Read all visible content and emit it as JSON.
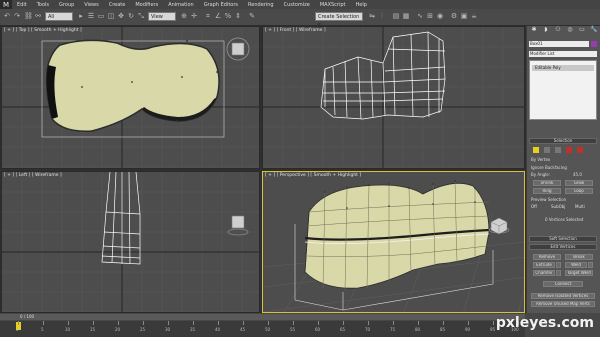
{
  "menubar": {
    "app_glyph": "M",
    "items": [
      "Edit",
      "Tools",
      "Group",
      "Views",
      "Create",
      "Modifiers",
      "Animation",
      "Graph Editors",
      "Rendering",
      "Customize",
      "MAXScript",
      "Help"
    ]
  },
  "toolbar": {
    "filter_value": "All",
    "refsys_value": "View",
    "named_sel_placeholder": "Create Selection S"
  },
  "viewports": {
    "top": {
      "label": "[ + ] [ Top ] [ Smooth + Highlight ]"
    },
    "front": {
      "label": "[ + ] [ Front ] [ Wireframe ]"
    },
    "left": {
      "label": "[ + ] [ Left ] [ Wireframe ]"
    },
    "perspective": {
      "label": "[ + ] [ Perspective ] [ Smooth + Highlight ]"
    }
  },
  "command_panel": {
    "object_name": "Box01",
    "modifier_list": "Modifier List",
    "stack_items": [
      "Editable Poly"
    ],
    "selection_title": "Selection",
    "by_vertex": "By Vertex",
    "ignore_backfacing": "Ignore Backfacing",
    "by_angle": "By Angle:",
    "by_angle_value": "45.0",
    "shrink": "Shrink",
    "grow": "Grow",
    "ring": "Ring",
    "loop": "Loop",
    "preview_selection": "Preview Selection",
    "preview_off": "Off",
    "preview_subobj": "SubObj",
    "preview_multi": "Multi",
    "vertices_selected": "0 Vertices Selected",
    "soft_selection": "Soft Selection",
    "edit_vertices": "Edit Vertices",
    "remove": "Remove",
    "break": "Break",
    "extrude": "Extrude",
    "weld": "Weld",
    "chamfer": "Chamfer",
    "target_weld": "Target Weld",
    "connect": "Connect",
    "remove_isolated": "Remove Isolated Vertices",
    "remove_unused": "Remove Unused Map Verts"
  },
  "timeline": {
    "frame_label": "0 / 100",
    "ticks": [
      "0",
      "5",
      "10",
      "15",
      "20",
      "25",
      "30",
      "35",
      "40",
      "45",
      "50",
      "55",
      "60",
      "65",
      "70",
      "75",
      "80",
      "85",
      "90",
      "95",
      "100"
    ]
  },
  "watermark": "pxleyes.com",
  "colors": {
    "active_border": "#d8c23a",
    "mesh_fill": "#d8d8a8",
    "wire": "#ffffff"
  }
}
